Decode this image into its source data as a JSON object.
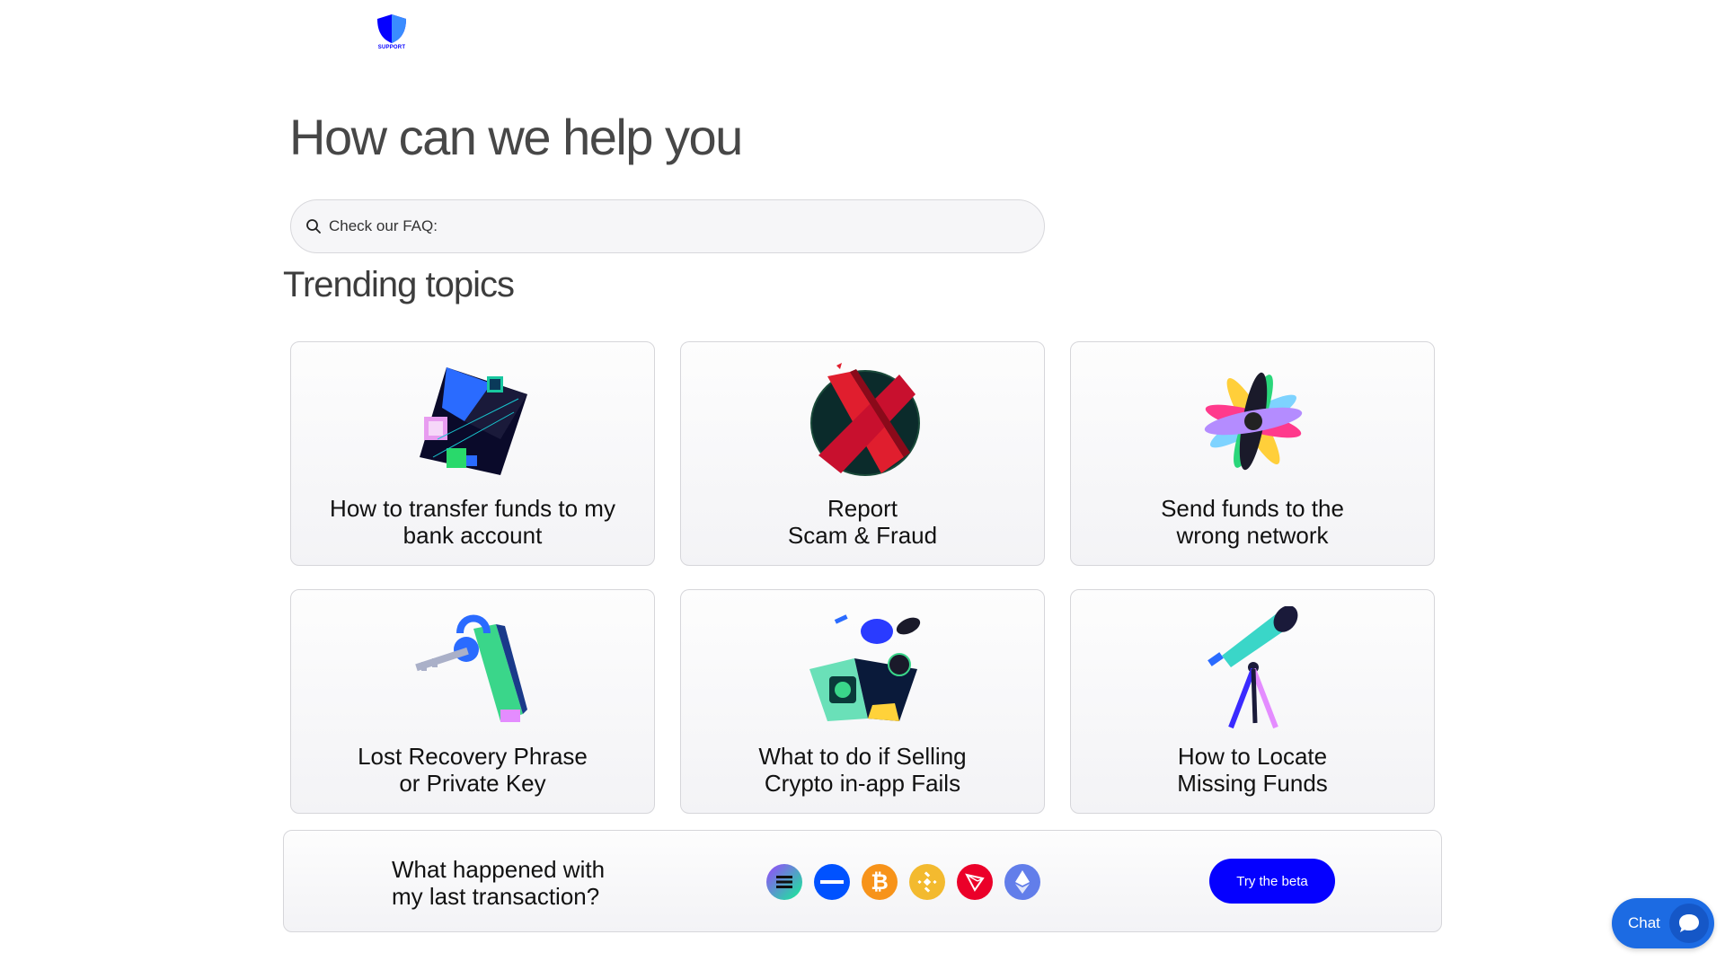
{
  "logo": {
    "text": "SUPPORT",
    "icon": "shield-icon",
    "color": "#0500ff"
  },
  "hero": {
    "title": "How can we help you"
  },
  "search": {
    "placeholder": "Check our FAQ:",
    "icon": "search-icon"
  },
  "trending": {
    "title": "Trending topics",
    "cards": [
      {
        "line1": "How to transfer funds to my",
        "line2": "bank account",
        "icon": "bank-transfer-illustration"
      },
      {
        "line1": "Report",
        "line2": "Scam & Fraud",
        "icon": "scam-x-illustration"
      },
      {
        "line1": "Send funds to the",
        "line2": "wrong network",
        "icon": "coins-fan-illustration"
      },
      {
        "line1": "Lost Recovery Phrase",
        "line2": "or Private Key",
        "icon": "key-illustration"
      },
      {
        "line1": "What to do if Selling",
        "line2": "Crypto in-app Fails",
        "icon": "wallet-coins-illustration"
      },
      {
        "line1": "How to Locate",
        "line2": "Missing Funds",
        "icon": "telescope-illustration"
      }
    ]
  },
  "transaction": {
    "line1": "What happened with",
    "line2": "my last transaction?",
    "coins": [
      "solana-icon",
      "minus-coin-icon",
      "bitcoin-icon",
      "bnb-icon",
      "tron-icon",
      "ethereum-icon"
    ],
    "button_label": "Try the beta"
  },
  "chat": {
    "label": "Chat",
    "icon": "chat-bubble-icon"
  },
  "colors": {
    "accent": "#0500ff",
    "chat": "#1c6be3"
  }
}
